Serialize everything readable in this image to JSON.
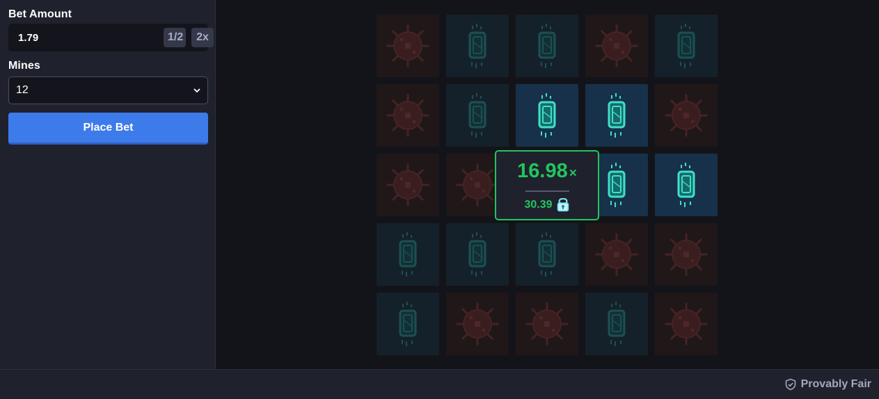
{
  "sidebar": {
    "bet_label": "Bet Amount",
    "bet_value": "1.79",
    "half_label": "1/2",
    "double_label": "2x",
    "mines_label": "Mines",
    "mines_value": "12",
    "place_bet_label": "Place Bet"
  },
  "board": {
    "rows": [
      [
        "mine-dim",
        "gem-dim",
        "gem-dim",
        "mine-dim",
        "gem-dim"
      ],
      [
        "mine-dim",
        "gem-dim",
        "gem-lit",
        "gem-lit",
        "mine-dim"
      ],
      [
        "mine-dim",
        "mine-dim",
        "gem-lit",
        "gem-lit",
        "gem-lit"
      ],
      [
        "gem-dim",
        "gem-dim",
        "gem-dim",
        "mine-dim",
        "mine-dim"
      ],
      [
        "gem-dim",
        "mine-dim",
        "mine-dim",
        "gem-dim",
        "mine-dim"
      ]
    ]
  },
  "cashout": {
    "multiplier": "16.98",
    "multiplier_suffix": "×",
    "win_amount": "30.39"
  },
  "footer": {
    "provably_fair_label": "Provably Fair"
  },
  "colors": {
    "accent_blue": "#3d7bea",
    "win_green": "#22c55e",
    "panel": "#1f212d",
    "background": "#13141a"
  },
  "icons": {
    "currency": "lock-coin-icon",
    "mine": "mine-icon",
    "gem": "gem-icon",
    "select": "chevron-down-icon",
    "fair": "shield-check-icon"
  }
}
